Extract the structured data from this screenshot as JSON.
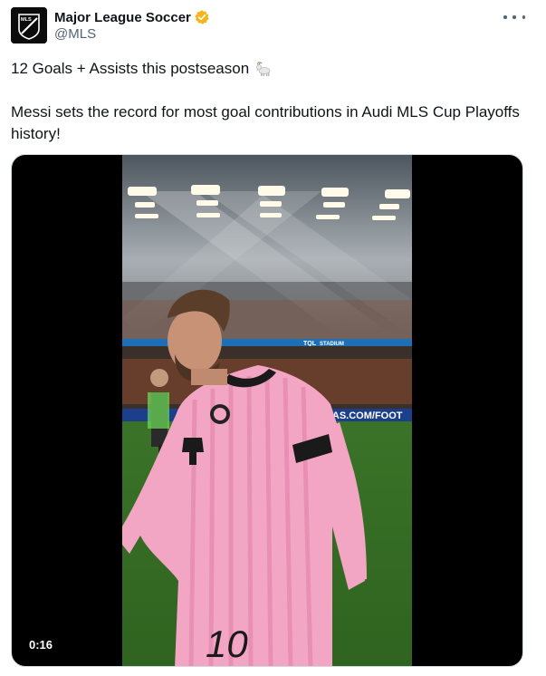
{
  "author": {
    "display_name": "Major League Soccer",
    "handle": "@MLS",
    "verified": true,
    "avatar_icon": "mls-logo-icon",
    "avatar_text": "MLS"
  },
  "tweet": {
    "line1": "12 Goals + Assists this postseason",
    "line1_emoji": "goat-icon",
    "line2": "Messi sets the record for most goal contributions in Audi MLS Cup Playoffs history!"
  },
  "media": {
    "type": "video",
    "duration": "0:16",
    "board_text_1": "ADIDAS.COM/FOOT",
    "board_text_2": "TQL",
    "board_text_3": "STADIUM",
    "jersey_number": "10"
  },
  "colors": {
    "verified_badge": "#f4b41a",
    "jersey_pink": "#f3a6c4",
    "pitch_green": "#3f7a2c",
    "text_primary": "#0f1419",
    "text_secondary": "#536471"
  }
}
